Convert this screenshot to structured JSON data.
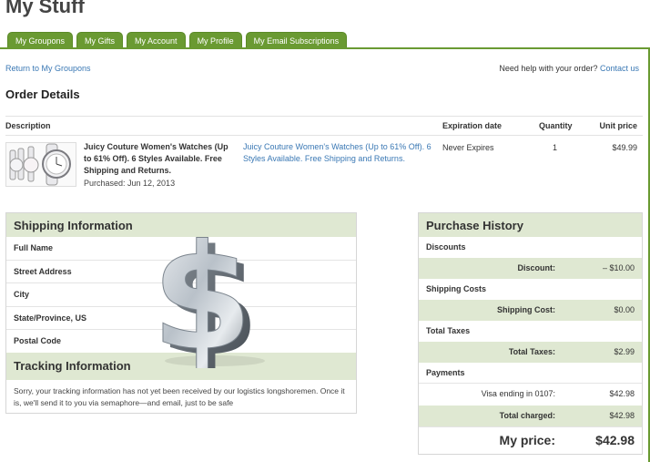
{
  "page": {
    "title": "My Stuff"
  },
  "tabs": [
    "My Groupons",
    "My Gifts",
    "My Account",
    "My Profile",
    "My Email Subscriptions"
  ],
  "nav": {
    "return_link": "Return to My Groupons",
    "help_text": "Need help with your order?",
    "help_link": "Contact us"
  },
  "order": {
    "title": "Order Details",
    "columns": {
      "description": "Description",
      "expiration": "Expiration date",
      "quantity": "Quantity",
      "unit_price": "Unit price"
    },
    "item": {
      "name": "Juicy Couture Women's Watches (Up to 61% Off). 6 Styles Available. Free Shipping and Returns.",
      "purchased": "Purchased: Jun 12, 2013",
      "link": "Juicy Couture Women's Watches (Up to 61% Off). 6 Styles Available. Free Shipping and Returns.",
      "expiration": "Never Expires",
      "quantity": "1",
      "unit_price": "$49.99",
      "thumbnail": "watch-product-image"
    }
  },
  "shipping": {
    "title": "Shipping Information",
    "fields": [
      "Full Name",
      "Street Address",
      "City",
      "State/Province, US",
      "Postal Code"
    ]
  },
  "tracking": {
    "title": "Tracking Information",
    "text": "Sorry, your tracking information has not yet been received by our logistics longshoremen. Once it is, we'll send it to you via semaphore—and email, just to be safe"
  },
  "history": {
    "title": "Purchase History",
    "discounts_label": "Discounts",
    "discount_label": "Discount:",
    "discount_value": "– $10.00",
    "shipping_costs_label": "Shipping Costs",
    "shipping_cost_label": "Shipping Cost:",
    "shipping_cost_value": "$0.00",
    "total_taxes_header": "Total Taxes",
    "total_taxes_label": "Total Taxes:",
    "total_taxes_value": "$2.99",
    "payments_label": "Payments",
    "visa_label": "Visa ending in 0107:",
    "visa_value": "$42.98",
    "total_charged_label": "Total charged:",
    "total_charged_value": "$42.98",
    "my_price_label": "My price:",
    "my_price_value": "$42.98"
  },
  "colors": {
    "accent": "#6a9a32",
    "panel_header": "#dfe8d2",
    "link": "#3a78b4"
  },
  "overlay": {
    "icon": "dollar-sign-icon"
  }
}
